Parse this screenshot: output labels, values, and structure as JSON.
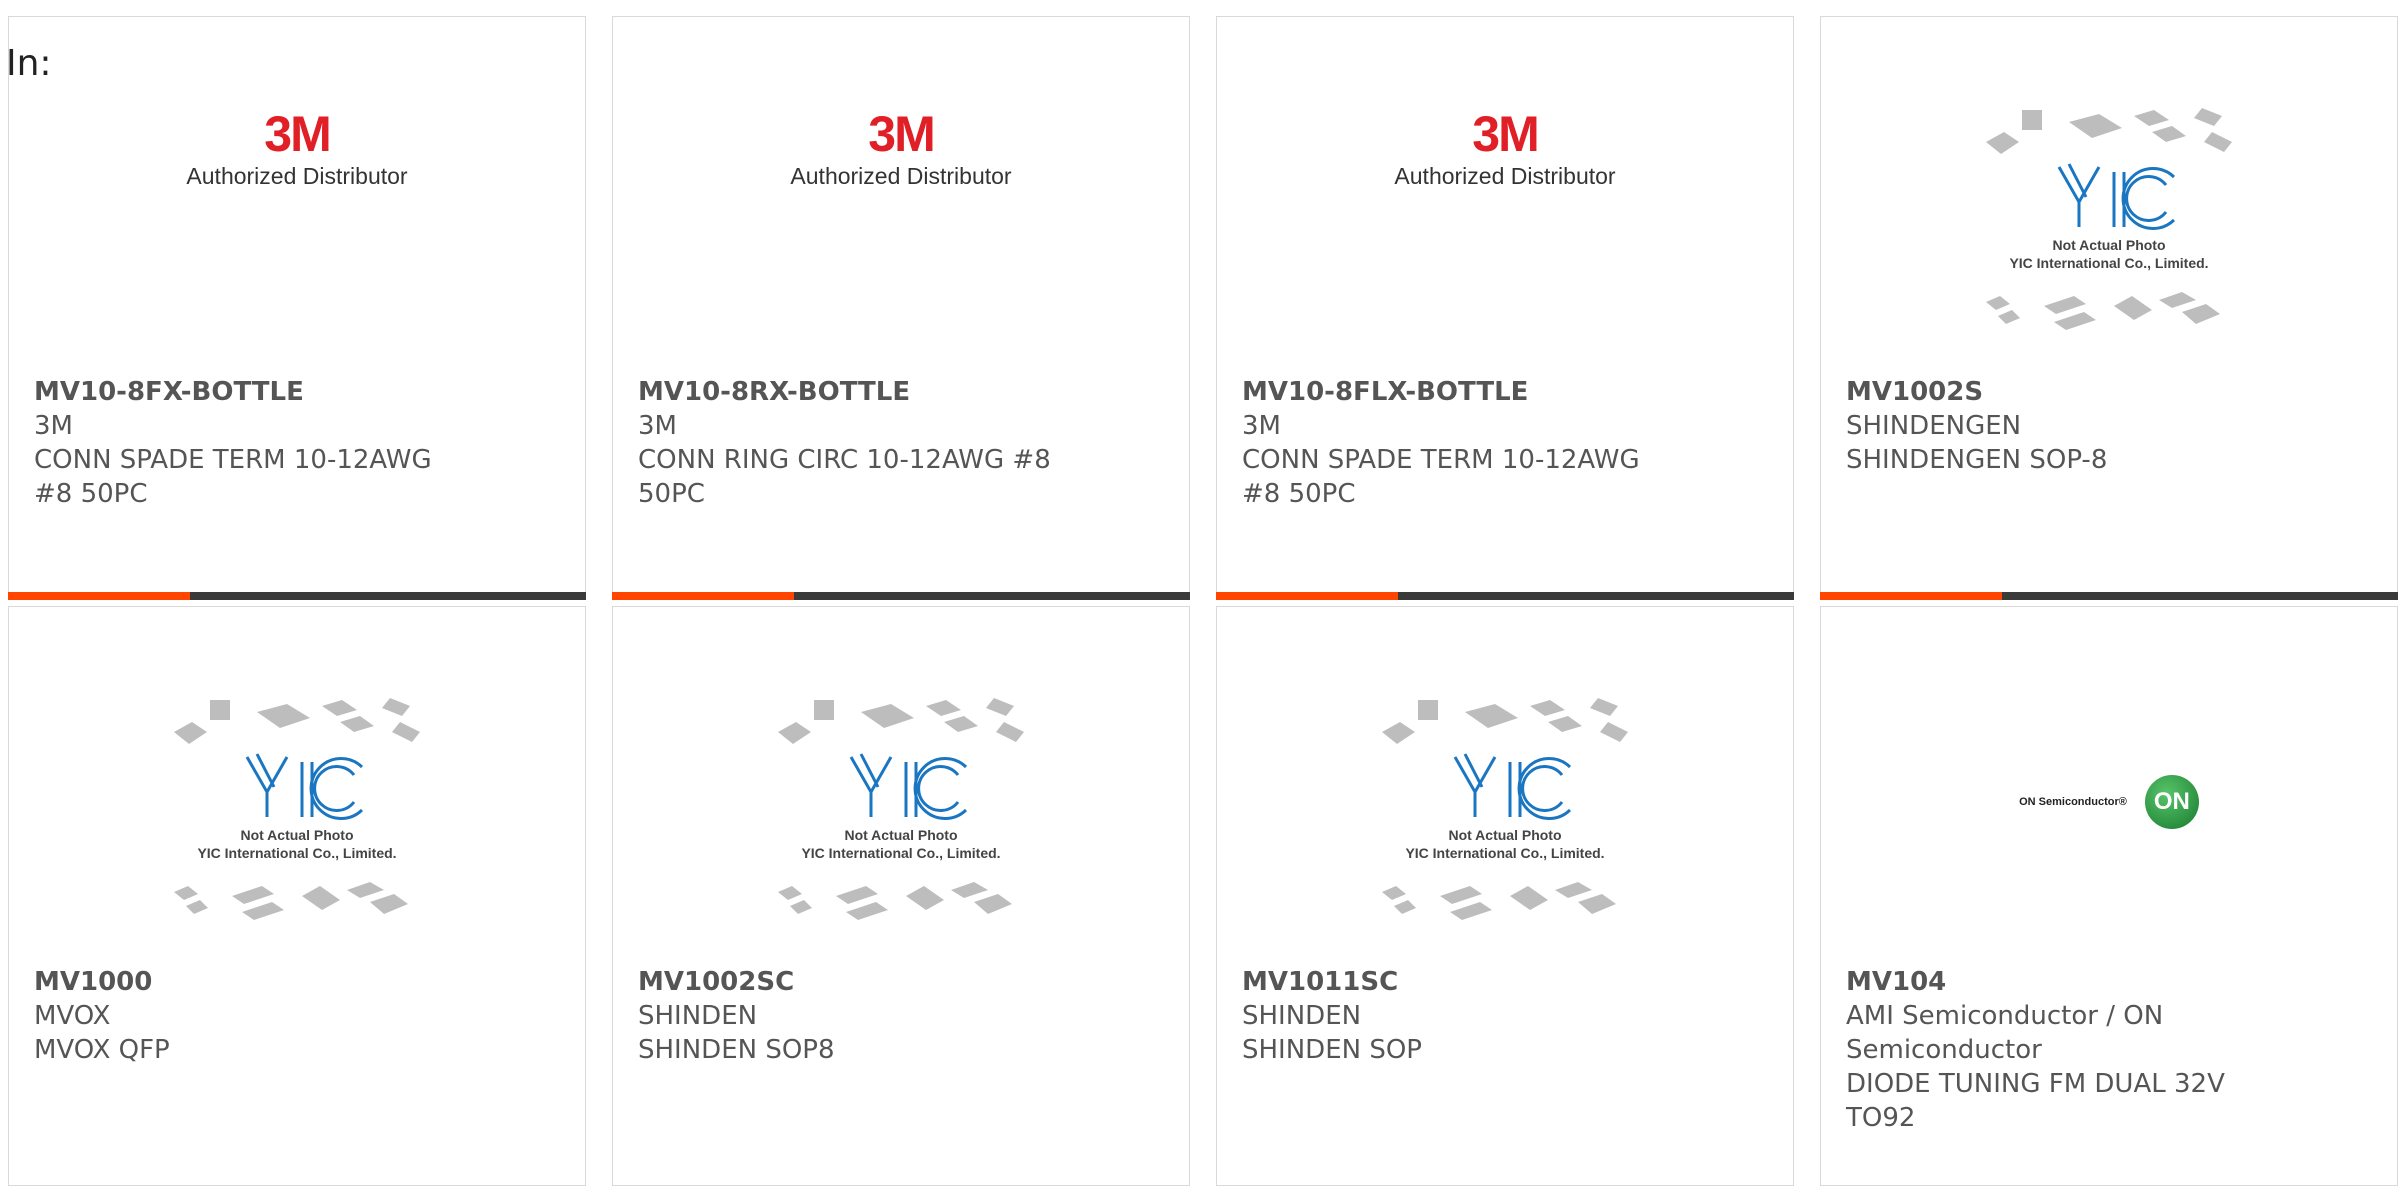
{
  "in_label": "In:",
  "logos": {
    "threem_mark": "3M",
    "threem_sub": "Authorized Distributor",
    "yic_line1": "Not Actual Photo",
    "yic_line2": "YIC International Co., Limited.",
    "on_text": "ON Semiconductor®",
    "on_badge": "ON"
  },
  "colors": {
    "accent": "#ff4500",
    "bar": "#3a3a3a",
    "threem_red": "#e01f26"
  },
  "products": [
    {
      "part": "MV10-8FX-BOTTLE",
      "maker": "3M",
      "desc": "CONN SPADE TERM 10-12AWG #8 50PC",
      "image": "3m-logo"
    },
    {
      "part": "MV10-8RX-BOTTLE",
      "maker": "3M",
      "desc": "CONN RING CIRC 10-12AWG #8 50PC",
      "image": "3m-logo"
    },
    {
      "part": "MV10-8FLX-BOTTLE",
      "maker": "3M",
      "desc": "CONN SPADE TERM 10-12AWG #8 50PC",
      "image": "3m-logo"
    },
    {
      "part": "MV1002S",
      "maker": "SHINDENGEN",
      "desc": "SHINDENGEN SOP-8",
      "image": "yic-placeholder"
    },
    {
      "part": "MV1000",
      "maker": "MVOX",
      "desc": "MVOX QFP",
      "image": "yic-placeholder"
    },
    {
      "part": "MV1002SC",
      "maker": "SHINDEN",
      "desc": "SHINDEN SOP8",
      "image": "yic-placeholder"
    },
    {
      "part": "MV1011SC",
      "maker": "SHINDEN",
      "desc": "SHINDEN SOP",
      "image": "yic-placeholder"
    },
    {
      "part": "MV104",
      "maker": "AMI Semiconductor / ON Semiconductor",
      "desc": "DIODE TUNING FM DUAL 32V TO92",
      "image": "on-semi-logo"
    }
  ]
}
